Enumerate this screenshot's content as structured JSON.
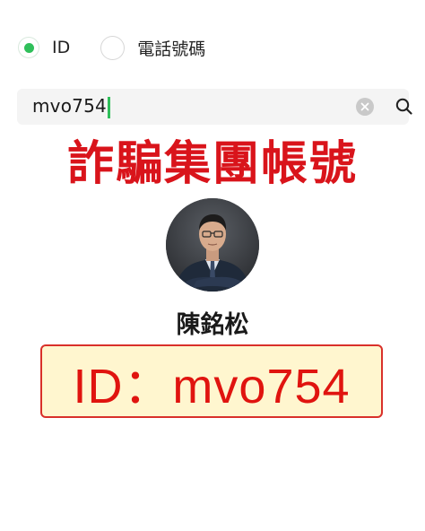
{
  "radio": {
    "options": [
      {
        "label": "ID",
        "selected": true
      },
      {
        "label": "電話號碼",
        "selected": false
      }
    ]
  },
  "search": {
    "value": "mvo754"
  },
  "headline": "詐騙集團帳號",
  "person": {
    "name": "陳銘松"
  },
  "id_box": {
    "text": "ID：mvo754"
  },
  "icons": {
    "clear": "clear-circle-icon",
    "search": "search-icon"
  },
  "colors": {
    "accent_green": "#2fbf5a",
    "headline_red": "#d9141b",
    "id_box_background": "#fff6cf",
    "id_box_text": "#e0140f"
  }
}
